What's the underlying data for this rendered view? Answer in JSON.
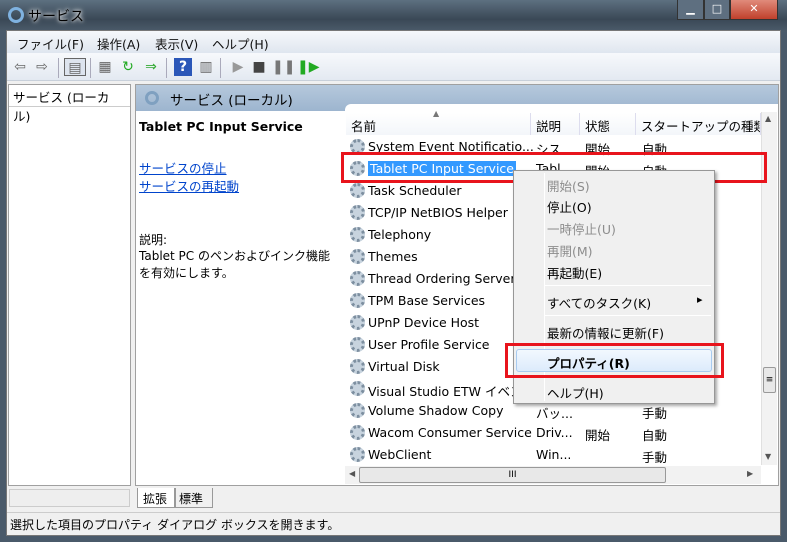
{
  "window": {
    "title": "サービス",
    "minimize": "▁",
    "maximize": "□",
    "close": "✕"
  },
  "menubar": [
    "ファイル(F)",
    "操作(A)",
    "表示(V)",
    "ヘルプ(H)"
  ],
  "toolbar": [
    "back-icon",
    "forward-icon",
    "show-hide-tree-icon",
    "properties-icon",
    "refresh-icon",
    "export-icon",
    "help-icon",
    "console-icon",
    "start-icon",
    "stop-icon",
    "pause-icon",
    "resume-icon"
  ],
  "left_pane": {
    "title": "サービス (ローカル)"
  },
  "right_pane": {
    "title": "サービス (ローカル)"
  },
  "extended": {
    "service_name": "Tablet PC Input Service",
    "links": [
      "サービスの停止",
      "サービスの再起動"
    ],
    "desc_label": "説明:",
    "description": "Tablet PC のペンおよびインク機能を有効にします。"
  },
  "columns": [
    "名前",
    "説明",
    "状態",
    "スタートアップの種類"
  ],
  "rows": [
    {
      "name": "System Event Notificatio...",
      "desc": "シス...",
      "status": "開始",
      "startup": "自動"
    },
    {
      "name": "Tablet PC Input Service",
      "desc": "Tabl...",
      "status": "開始",
      "startup": "自動",
      "selected": true
    },
    {
      "name": "Task Scheduler",
      "desc": "",
      "status": "",
      "startup": ""
    },
    {
      "name": "TCP/IP NetBIOS Helper",
      "desc": "",
      "status": "",
      "startup": ""
    },
    {
      "name": "Telephony",
      "desc": "",
      "status": "",
      "startup": ""
    },
    {
      "name": "Themes",
      "desc": "",
      "status": "",
      "startup": ""
    },
    {
      "name": "Thread Ordering Server",
      "desc": "",
      "status": "",
      "startup": ""
    },
    {
      "name": "TPM Base Services",
      "desc": "",
      "status": "",
      "startup": ""
    },
    {
      "name": "UPnP Device Host",
      "desc": "",
      "status": "",
      "startup": ""
    },
    {
      "name": "User Profile Service",
      "desc": "",
      "status": "",
      "startup": ""
    },
    {
      "name": "Virtual Disk",
      "desc": "",
      "status": "",
      "startup": ""
    },
    {
      "name": "Visual Studio ETW イベン",
      "desc": "",
      "status": "",
      "startup": ""
    },
    {
      "name": "Volume Shadow Copy",
      "desc": "バッ...",
      "status": "",
      "startup": "手動"
    },
    {
      "name": "Wacom Consumer Service",
      "desc": "Driv...",
      "status": "開始",
      "startup": "自動"
    },
    {
      "name": "WebClient",
      "desc": "Win...",
      "status": "",
      "startup": "手動"
    }
  ],
  "context_menu": [
    {
      "label": "開始(S)",
      "disabled": true
    },
    {
      "label": "停止(O)"
    },
    {
      "label": "一時停止(U)",
      "disabled": true
    },
    {
      "label": "再開(M)",
      "disabled": true
    },
    {
      "label": "再起動(E)"
    },
    {
      "label": "すべてのタスク(K)",
      "submenu": "▸"
    },
    {
      "label": "最新の情報に更新(F)"
    },
    {
      "label": "プロパティ(R)",
      "bold": true,
      "highlighted": true
    },
    {
      "label": "ヘルプ(H)"
    }
  ],
  "tabs": [
    "拡張",
    "標準"
  ],
  "status": "選択した項目のプロパティ ダイアログ ボックスを開きます。",
  "colors": {
    "selection": "#3399ff",
    "highlight_box": "#e8141c",
    "header": "#a9bfd6"
  }
}
